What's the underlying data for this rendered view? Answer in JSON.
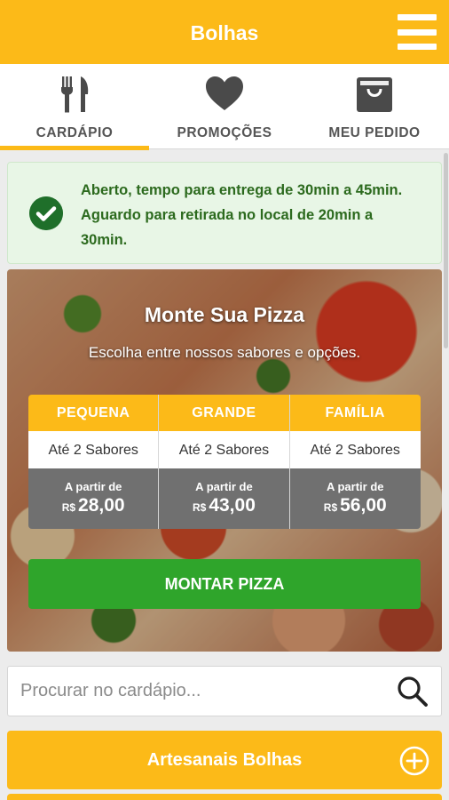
{
  "header": {
    "title": "Bolhas",
    "menu_icon": "hamburger-icon"
  },
  "tabs": [
    {
      "label": "CARDÁPIO",
      "icon": "fork-knife-icon",
      "active": true
    },
    {
      "label": "PROMOÇÕES",
      "icon": "heart-icon",
      "active": false
    },
    {
      "label": "MEU PEDIDO",
      "icon": "shopping-bag-icon",
      "active": false
    }
  ],
  "status": {
    "icon": "check-circle-icon",
    "text": "Aberto, tempo para entrega de 30min a 45min. Aguardo para retirada no local de 20min a 30min."
  },
  "pizza_builder": {
    "title": "Monte Sua Pizza",
    "subtitle": "Escolha entre nossos sabores e opções.",
    "sizes": [
      {
        "name": "PEQUENA",
        "flavors": "Até 2 Sabores",
        "price_label": "A partir de",
        "currency": "R$",
        "price": "28,00"
      },
      {
        "name": "GRANDE",
        "flavors": "Até 2 Sabores",
        "price_label": "A partir de",
        "currency": "R$",
        "price": "43,00"
      },
      {
        "name": "FAMÍLIA",
        "flavors": "Até 2 Sabores",
        "price_label": "A partir de",
        "currency": "R$",
        "price": "56,00"
      }
    ],
    "button_label": "MONTAR PIZZA"
  },
  "search": {
    "placeholder": "Procurar no cardápio...",
    "value": "",
    "icon": "search-icon"
  },
  "categories": [
    {
      "label": "Artesanais Bolhas",
      "icon": "plus-circle-icon"
    }
  ],
  "colors": {
    "accent": "#fcba18",
    "success": "#2fa52b",
    "status_bg": "#e8f6e6",
    "status_text": "#2c6a1e",
    "price_bg": "#707070"
  }
}
